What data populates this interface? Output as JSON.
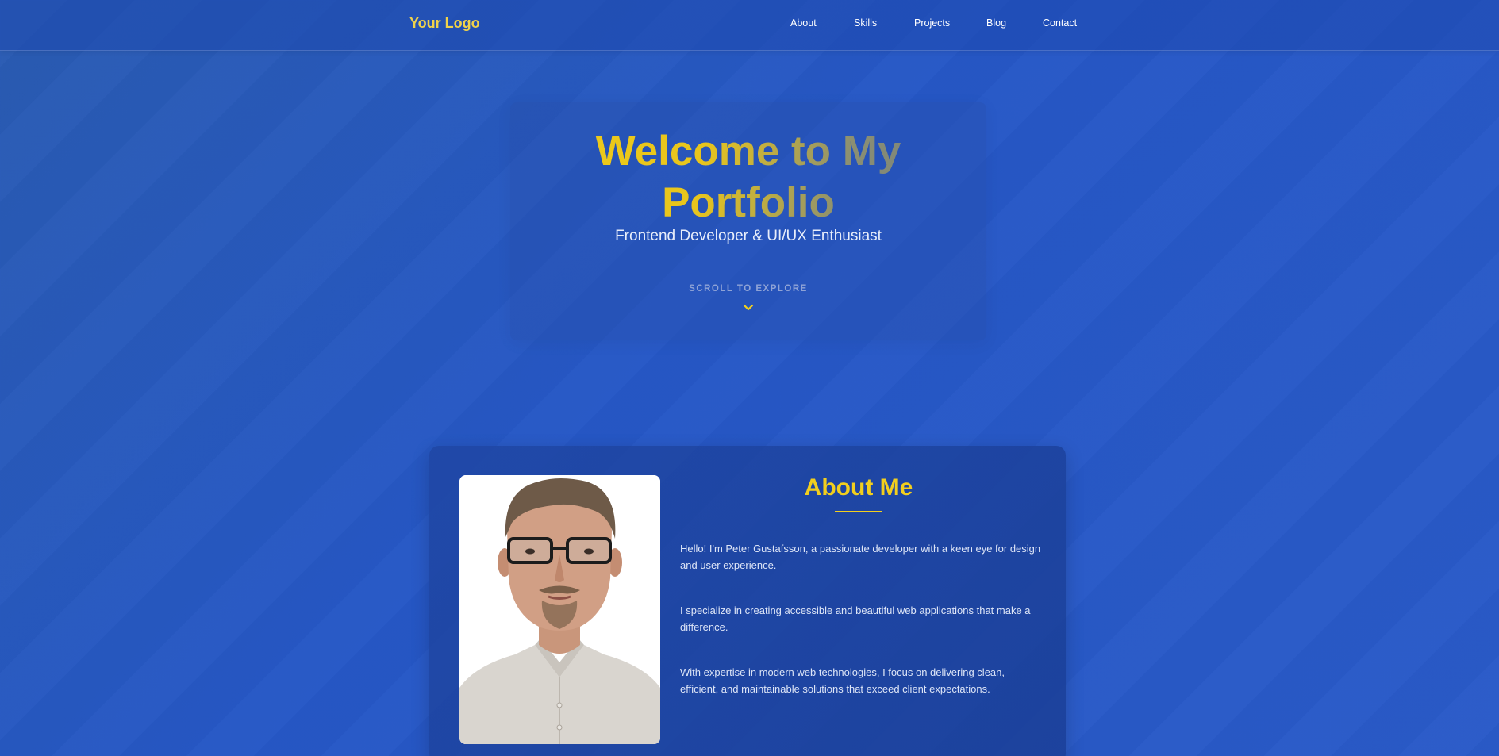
{
  "nav": {
    "logo": "Your Logo",
    "links": [
      {
        "label": "About"
      },
      {
        "label": "Skills"
      },
      {
        "label": "Projects"
      },
      {
        "label": "Blog"
      },
      {
        "label": "Contact"
      }
    ]
  },
  "hero": {
    "title_line1": "Welcome to My",
    "title_line2": "Portfolio",
    "subtitle": "Frontend Developer & UI/UX Enthusiast",
    "scroll_label": "SCROLL TO EXPLORE",
    "scroll_icon": "chevron-down-icon"
  },
  "about": {
    "title": "About Me",
    "photo_icon": "profile-photo",
    "paragraphs": [
      "Hello! I'm Peter Gustafsson, a passionate developer with a keen eye for design and user experience.",
      "I specialize in creating accessible and beautiful web applications that make a difference.",
      "With expertise in modern web technologies, I focus on delivering clean, efficient, and maintainable solutions that exceed client expectations."
    ]
  },
  "colors": {
    "accent": "#f2cf1e",
    "background": "#2657c6",
    "text_light": "#dde5f7"
  }
}
